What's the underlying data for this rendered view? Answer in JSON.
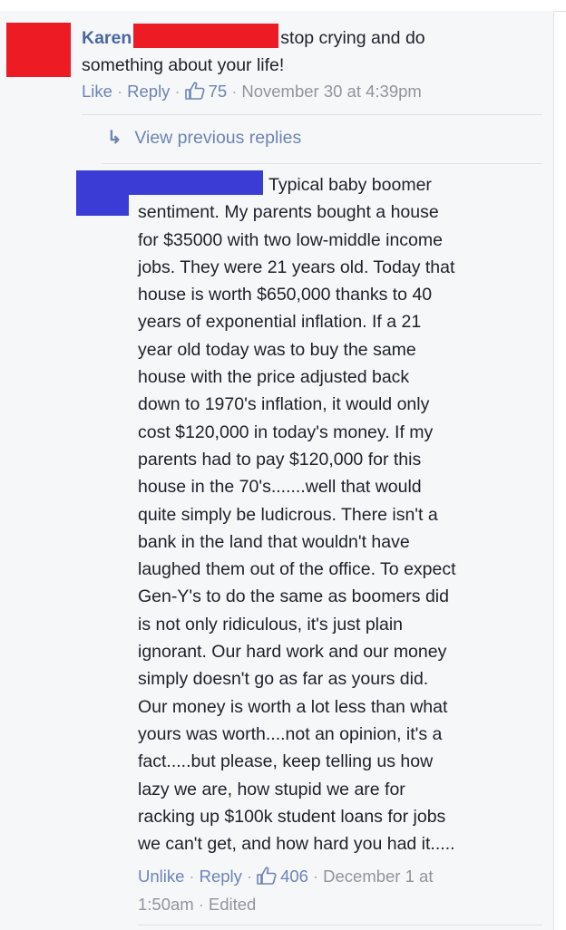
{
  "main_comment": {
    "author": "Karen",
    "text_line1": "stop crying and do",
    "text_line2": "something about your life!",
    "actions": {
      "like": "Like",
      "reply": "Reply",
      "likes_count": "75",
      "timestamp": "November 30 at 4:39pm"
    }
  },
  "view_previous_replies": "View previous replies",
  "reply_comment": {
    "lines": [
      "Typical baby boomer",
      "sentiment. My parents bought a house",
      "for $35000 with two low-middle income",
      "jobs. They were 21 years old. Today that",
      "house is worth $650,000 thanks to 40",
      "years of exponential inflation. If a 21",
      "year old today was to buy the same",
      "house with the price adjusted back",
      "down to 1970's inflation, it would only",
      "cost $120,000 in today's money. If my",
      "parents had to pay $120,000 for this",
      "house in the 70's.......well that would",
      "quite simply be ludicrous. There isn't a",
      "bank in the land that wouldn't have",
      "laughed them out of the office. To expect",
      "Gen-Y's to do the same as boomers did",
      "is not only ridiculous, it's just plain",
      "ignorant. Our hard work and our money",
      "simply doesn't go as far as yours did.",
      "Our money is worth a lot less than what",
      "yours was worth....not an opinion, it's a",
      "fact.....but please, keep telling us how",
      "lazy we are, how stupid we are for",
      "racking up $100k student loans for jobs",
      "we can't get, and how hard you had it....."
    ],
    "actions": {
      "unlike": "Unlike",
      "reply": "Reply",
      "likes_count": "406",
      "timestamp_part1": "December 1 at",
      "timestamp_part2": "1:50am",
      "edited": "Edited"
    }
  },
  "colors": {
    "link": "#6d84b4",
    "name": "#4b67a1",
    "meta": "#90949c",
    "redaction_red": "#ed1c24",
    "redaction_blue": "#3b3bd6"
  }
}
